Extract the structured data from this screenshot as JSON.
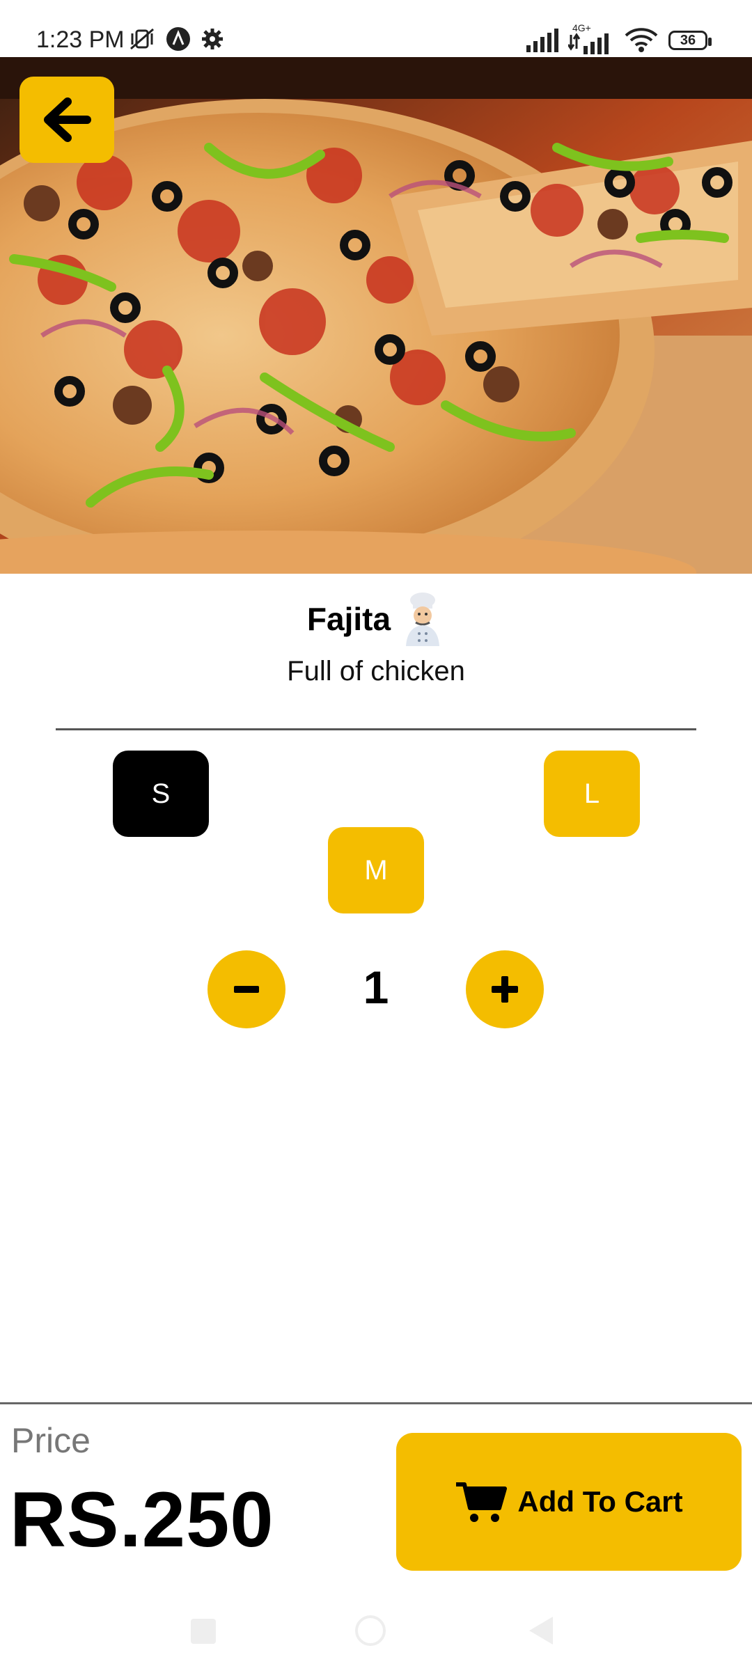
{
  "status_bar": {
    "time": "1:23 PM",
    "left_icons": [
      "mute-vibrate-icon",
      "app-a-icon",
      "settings-gear-icon"
    ],
    "right_icons": [
      "signal-icon",
      "signal-4g-icon",
      "wifi-icon"
    ],
    "network_label": "4G+",
    "battery": "36"
  },
  "header": {
    "back_icon": "arrow-left-icon"
  },
  "product": {
    "name": "Fajita",
    "emoji_icon": "chef-icon",
    "description": "Full of chicken"
  },
  "sizes": {
    "small": "S",
    "medium": "M",
    "large": "L",
    "selected": "S"
  },
  "quantity": {
    "value": "1",
    "decrement_icon": "minus-icon",
    "increment_icon": "plus-icon"
  },
  "footer": {
    "price_label": "Price",
    "price_value": "RS.250",
    "add_to_cart_label": "Add To Cart",
    "cart_icon": "cart-icon"
  },
  "colors": {
    "accent": "#f4bd00",
    "selected": "#000000"
  }
}
